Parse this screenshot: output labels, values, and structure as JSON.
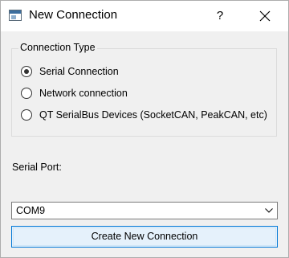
{
  "window": {
    "title": "New Connection",
    "help_glyph": "?",
    "app_icon": "window-app-icon",
    "close_icon": "close-icon"
  },
  "connection_type": {
    "title": "Connection Type",
    "options": [
      {
        "label": "Serial Connection",
        "checked": true
      },
      {
        "label": "Network connection",
        "checked": false
      },
      {
        "label": "QT SerialBus Devices (SocketCAN, PeakCAN, etc)",
        "checked": false
      }
    ]
  },
  "serial_port": {
    "label": "Serial Port:",
    "selected": "COM9",
    "dropdown_icon": "chevron-down-icon"
  },
  "actions": {
    "create_label": "Create New Connection"
  },
  "colors": {
    "button_border": "#0078d7",
    "button_fill": "#e5f1fb",
    "window_bg": "#f0f0f0"
  }
}
